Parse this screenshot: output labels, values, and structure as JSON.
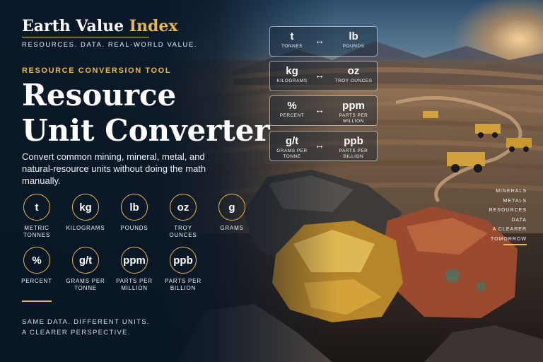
{
  "brand": {
    "name_main": "Earth Value",
    "name_accent": "Index",
    "tagline": "RESOURCES. DATA. REAL-WORLD VALUE."
  },
  "hero": {
    "eyebrow": "RESOURCE CONVERSION TOOL",
    "title_line1": "Resource",
    "title_line2": "Unit Converter",
    "subtitle": "Convert common mining, mineral, metal, and natural-resource units without doing the math manually."
  },
  "units": [
    {
      "symbol": "t",
      "label": "METRIC TONNES"
    },
    {
      "symbol": "kg",
      "label": "KILOGRAMS"
    },
    {
      "symbol": "lb",
      "label": "POUNDS"
    },
    {
      "symbol": "oz",
      "label": "TROY OUNCES"
    },
    {
      "symbol": "g",
      "label": "GRAMS"
    },
    {
      "symbol": "%",
      "label": "PERCENT"
    },
    {
      "symbol": "g/t",
      "label": "GRAMS PER TONNE"
    },
    {
      "symbol": "ppm",
      "label": "PARTS PER MILLION"
    },
    {
      "symbol": "ppb",
      "label": "PARTS PER BILLION"
    }
  ],
  "conversions": [
    {
      "from_symbol": "t",
      "from_label": "TONNES",
      "to_symbol": "lb",
      "to_label": "POUNDS"
    },
    {
      "from_symbol": "kg",
      "from_label": "KILOGRAMS",
      "to_symbol": "oz",
      "to_label": "TROY OUNCES"
    },
    {
      "from_symbol": "%",
      "from_label": "PERCENT",
      "to_symbol": "ppm",
      "to_label": "PARTS PER MILLION"
    },
    {
      "from_symbol": "g/t",
      "from_label": "GRAMS PER TONNE",
      "to_symbol": "ppb",
      "to_label": "PARTS PER BILLION"
    }
  ],
  "arrow_glyph": "↔",
  "side_list": [
    "MINERALS",
    "METALS",
    "RESOURCES",
    "DATA",
    "A CLEARER",
    "TOMORROW"
  ],
  "footer": {
    "line1": "SAME DATA. DIFFERENT UNITS.",
    "line2": "A CLEARER PERSPECTIVE."
  },
  "colors": {
    "accent": "#e8b94a",
    "navy": "#0b1a2b",
    "text": "#ffffff"
  }
}
